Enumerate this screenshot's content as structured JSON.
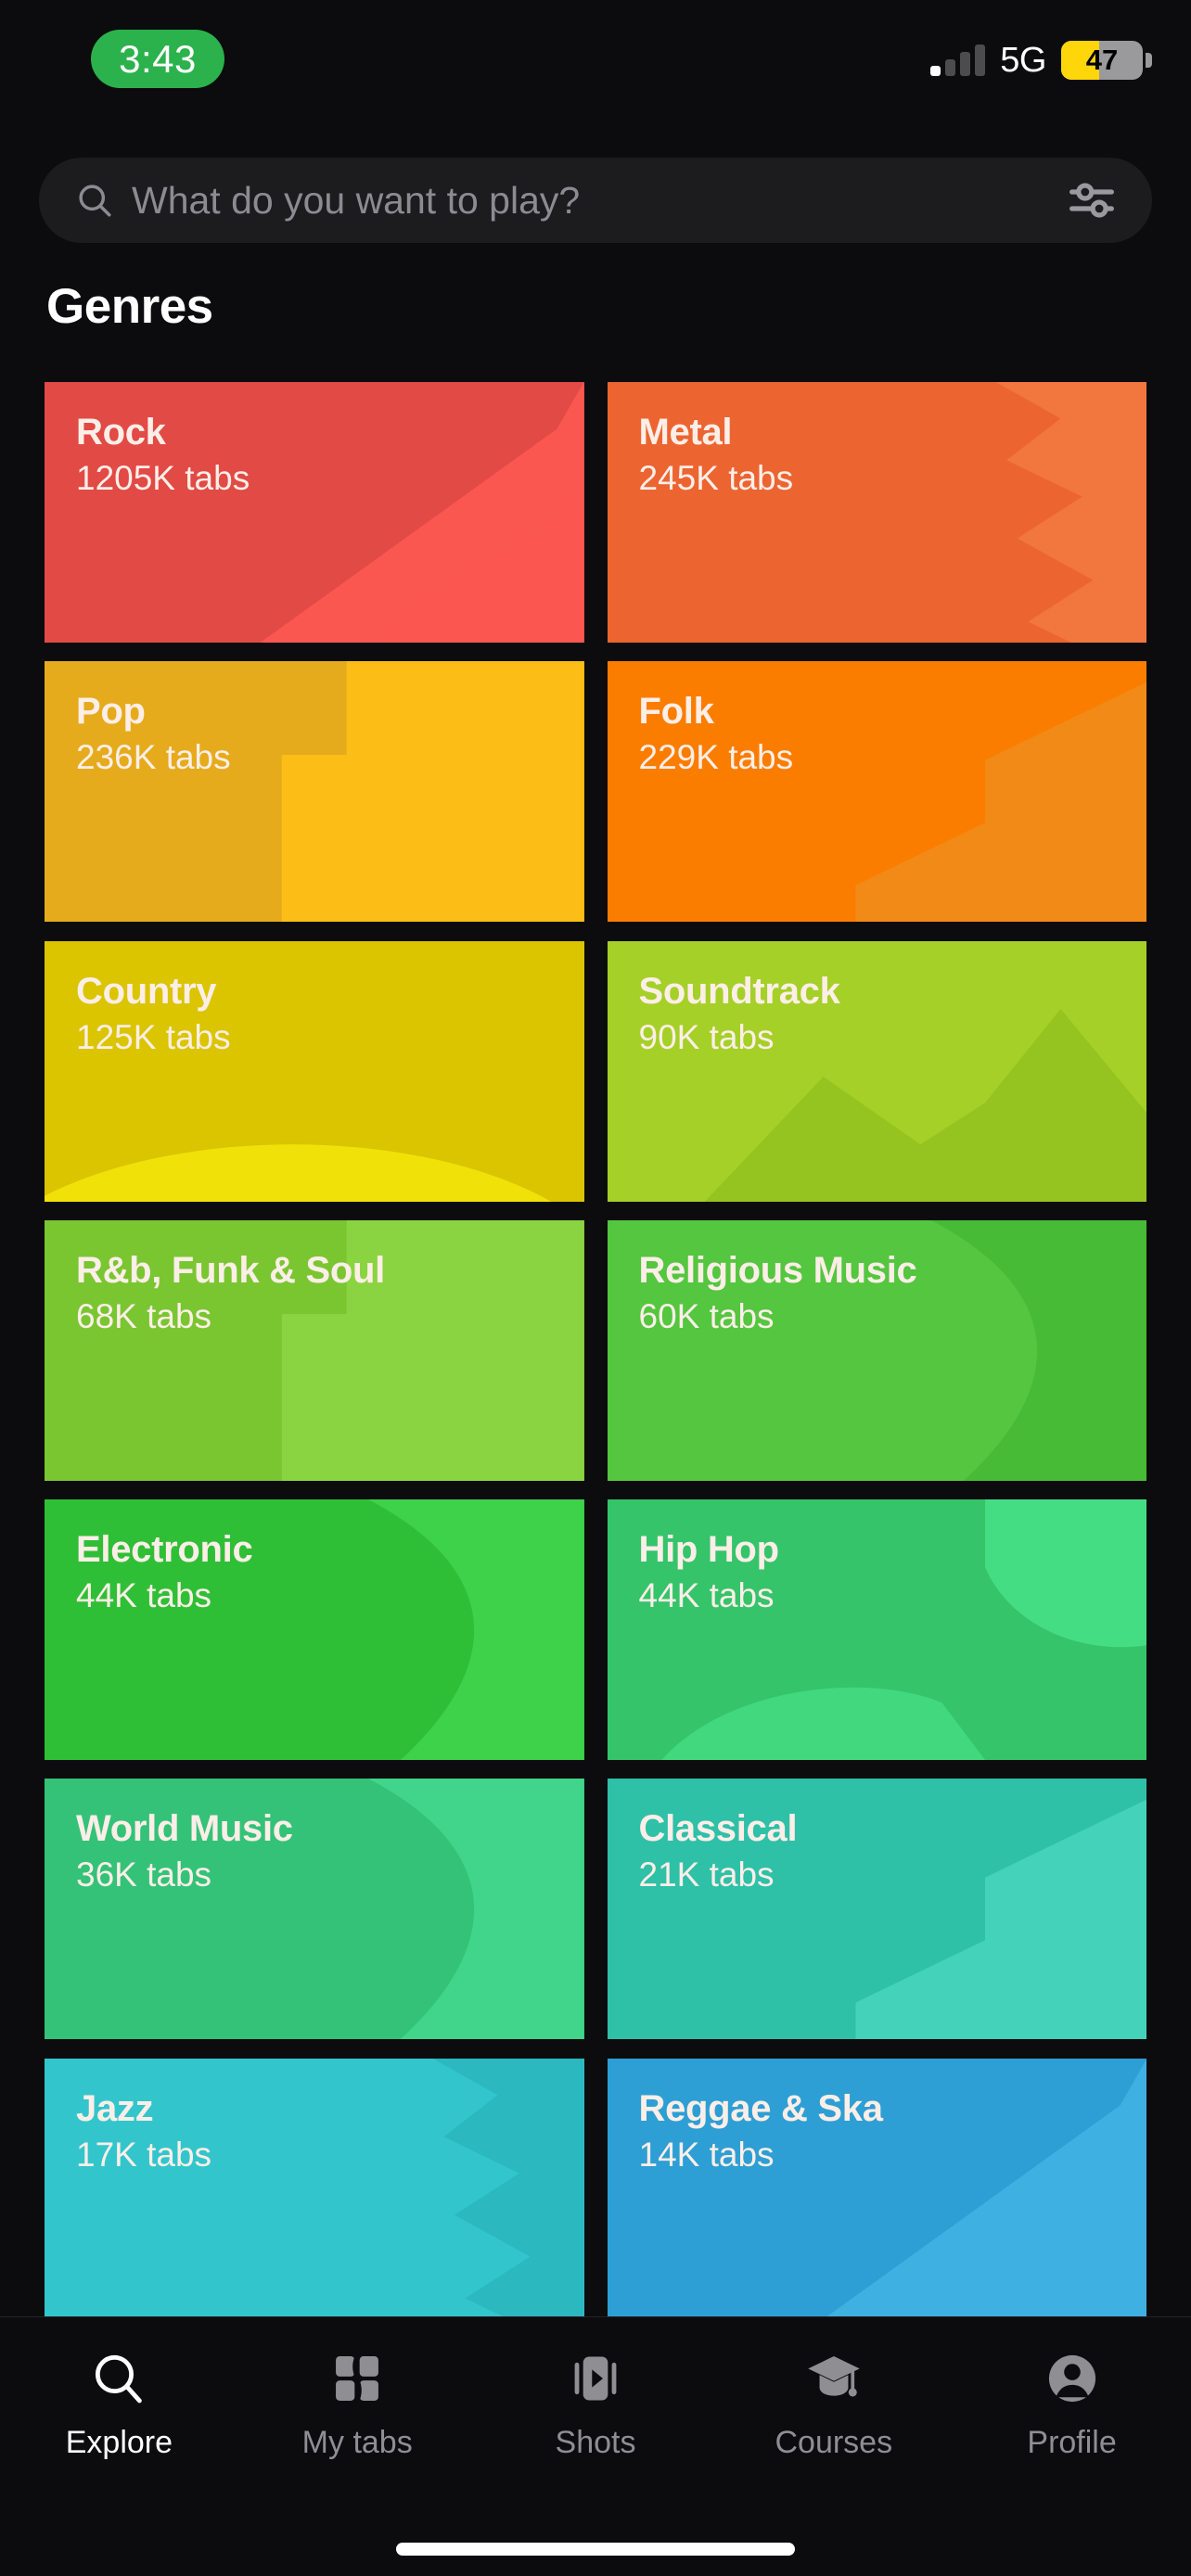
{
  "status_bar": {
    "time": "3:43",
    "time_pill_color": "#2bb24c",
    "network": "5G",
    "battery_percent": "47",
    "battery_color": "#ffd60a",
    "signal_bars_total": 4,
    "signal_bars_active": 1
  },
  "search": {
    "placeholder": "What do you want to play?",
    "value": "",
    "search_icon": "search-icon",
    "filter_icon": "sliders-filter-icon",
    "background": "#1c1c1e"
  },
  "section": {
    "title": "Genres"
  },
  "genres": [
    {
      "name": "Rock",
      "count": "1205K tabs",
      "color": "#e24a45",
      "deco": "#fb5751",
      "shape": "diagonal"
    },
    {
      "name": "Metal",
      "count": "245K tabs",
      "color": "#ec6531",
      "deco": "#f2773f",
      "shape": "zigzag"
    },
    {
      "name": "Pop",
      "count": "236K tabs",
      "color": "#e6ab1c",
      "deco": "#fcbe16",
      "shape": "block"
    },
    {
      "name": "Folk",
      "count": "229K tabs",
      "color": "#fb7d00",
      "deco": "#f28a17",
      "shape": "stair"
    },
    {
      "name": "Country",
      "count": "125K tabs",
      "color": "#dbc400",
      "deco": "#f0e209",
      "shape": "sun"
    },
    {
      "name": "Soundtrack",
      "count": "90K tabs",
      "color": "#a5d028",
      "deco": "#95c31f",
      "shape": "mountain"
    },
    {
      "name": "R&b, Funk & Soul",
      "count": "68K tabs",
      "color": "#79c631",
      "deco": "#8bd441",
      "shape": "block"
    },
    {
      "name": "Religious Music",
      "count": "60K tabs",
      "color": "#54c63f",
      "deco": "#47bb35",
      "shape": "curve"
    },
    {
      "name": "Electronic",
      "count": "44K tabs",
      "color": "#2fbf36",
      "deco": "#3ed14a",
      "shape": "curve"
    },
    {
      "name": "Hip Hop",
      "count": "44K tabs",
      "color": "#35c46a",
      "deco": "#45dd83",
      "shape": "blob"
    },
    {
      "name": "World Music",
      "count": "36K tabs",
      "color": "#34c278",
      "deco": "#41d48b",
      "shape": "curve"
    },
    {
      "name": "Classical",
      "count": "21K tabs",
      "color": "#2fc0a8",
      "deco": "#45d2ba",
      "shape": "stair"
    },
    {
      "name": "Jazz",
      "count": "17K tabs",
      "color": "#32c6cc",
      "deco": "#2bb8bf",
      "shape": "zigzag"
    },
    {
      "name": "Reggae & Ska",
      "count": "14K tabs",
      "color": "#2d9fd4",
      "deco": "#3fb0e2",
      "shape": "diagonal"
    }
  ],
  "tab_bar": {
    "items": [
      {
        "label": "Explore",
        "icon": "search-icon",
        "active": true
      },
      {
        "label": "My tabs",
        "icon": "grid-tabs-icon",
        "active": false
      },
      {
        "label": "Shots",
        "icon": "video-play-icon",
        "active": false
      },
      {
        "label": "Courses",
        "icon": "graduation-cap-icon",
        "active": false
      },
      {
        "label": "Profile",
        "icon": "person-avatar-icon",
        "active": false
      }
    ]
  }
}
